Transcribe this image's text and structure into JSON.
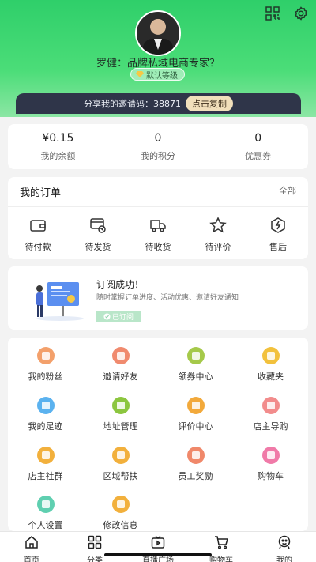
{
  "colors": {
    "brand_green": "#2fcf6a",
    "invite_bg": "#2f3549",
    "copy_btn": "#f1dfbb"
  },
  "profile": {
    "name": "罗健：品牌私域电商专家？",
    "level": "默认等级"
  },
  "invite": {
    "text": "分享我的邀请码：38871",
    "copy_label": "点击复制"
  },
  "stats": [
    {
      "value": "¥0.15",
      "label": "我的余额"
    },
    {
      "value": "0",
      "label": "我的积分"
    },
    {
      "value": "0",
      "label": "优惠券"
    }
  ],
  "orders": {
    "title": "我的订单",
    "all": "全部",
    "items": [
      {
        "label": "待付款",
        "icon": "wallet-icon"
      },
      {
        "label": "待发货",
        "icon": "pending-ship-icon"
      },
      {
        "label": "待收货",
        "icon": "truck-icon"
      },
      {
        "label": "待评价",
        "icon": "star-icon"
      },
      {
        "label": "售后",
        "icon": "after-sale-icon"
      }
    ]
  },
  "subscribe": {
    "title": "订阅成功！",
    "desc": "随时掌握订单进度、活动优惠、邀请好友通知",
    "badge": "已订阅"
  },
  "grid": [
    {
      "label": "我的粉丝",
      "color": "#f3a06b"
    },
    {
      "label": "邀请好友",
      "color": "#f08a6e"
    },
    {
      "label": "领券中心",
      "color": "#a5c94a"
    },
    {
      "label": "收藏夹",
      "color": "#f2c13c"
    },
    {
      "label": "我的足迹",
      "color": "#5bb2ef"
    },
    {
      "label": "地址管理",
      "color": "#8cc63f"
    },
    {
      "label": "评价中心",
      "color": "#f2a93b"
    },
    {
      "label": "店主导购",
      "color": "#f28c8c"
    },
    {
      "label": "店主社群",
      "color": "#f2b03c"
    },
    {
      "label": "区域帮扶",
      "color": "#f2b03c"
    },
    {
      "label": "员工奖励",
      "color": "#f0886a"
    },
    {
      "label": "购物车",
      "color": "#f07aa8"
    },
    {
      "label": "个人设置",
      "color": "#5fcfb0"
    },
    {
      "label": "修改信息",
      "color": "#f2b03c"
    }
  ],
  "nav": [
    {
      "label": "首页",
      "icon": "home-icon"
    },
    {
      "label": "分类",
      "icon": "category-icon"
    },
    {
      "label": "直播广场",
      "icon": "live-icon"
    },
    {
      "label": "购物车",
      "icon": "cart-icon"
    },
    {
      "label": "我的",
      "icon": "profile-icon"
    }
  ]
}
